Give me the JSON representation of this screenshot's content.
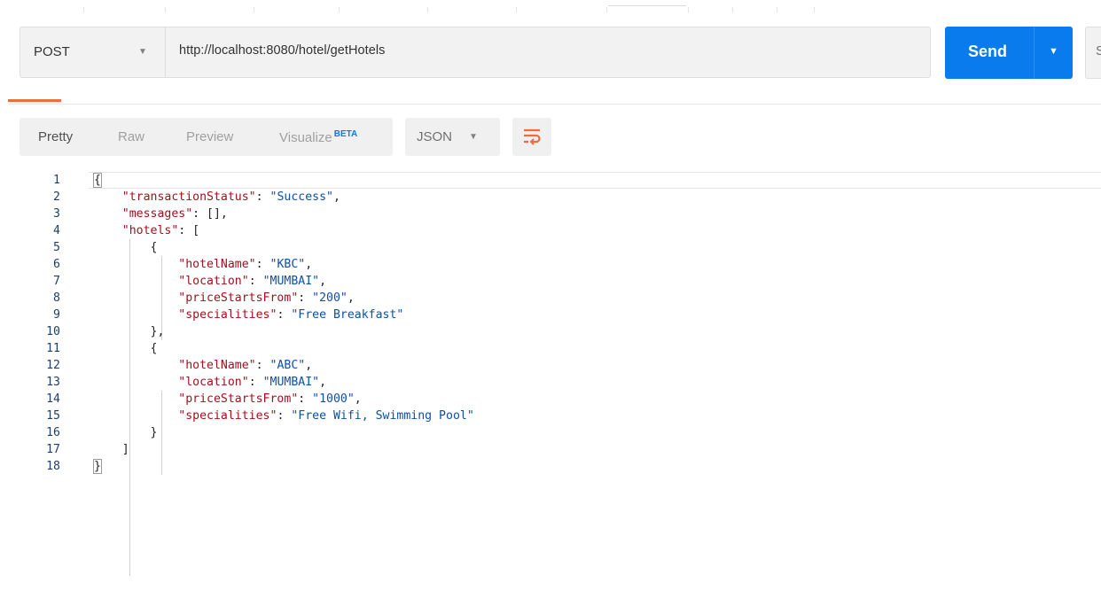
{
  "request": {
    "method": "POST",
    "url": "http://localhost:8080/hotel/getHotels",
    "send_label": "Send",
    "save_label": "S"
  },
  "response": {
    "view_tabs": [
      {
        "label": "Pretty",
        "active": true
      },
      {
        "label": "Raw",
        "active": false
      },
      {
        "label": "Preview",
        "active": false
      },
      {
        "label": "Visualize",
        "badge": "BETA",
        "active": false
      }
    ],
    "format": "JSON",
    "wrap_icon": "text-wrap-icon",
    "code_lines": [
      {
        "n": "1",
        "text": "{"
      },
      {
        "n": "2",
        "text": "    \"transactionStatus\": \"Success\","
      },
      {
        "n": "3",
        "text": "    \"messages\": [],"
      },
      {
        "n": "4",
        "text": "    \"hotels\": ["
      },
      {
        "n": "5",
        "text": "        {"
      },
      {
        "n": "6",
        "text": "            \"hotelName\": \"KBC\","
      },
      {
        "n": "7",
        "text": "            \"location\": \"MUMBAI\","
      },
      {
        "n": "8",
        "text": "            \"priceStartsFrom\": \"200\","
      },
      {
        "n": "9",
        "text": "            \"specialities\": \"Free Breakfast\""
      },
      {
        "n": "10",
        "text": "        },"
      },
      {
        "n": "11",
        "text": "        {"
      },
      {
        "n": "12",
        "text": "            \"hotelName\": \"ABC\","
      },
      {
        "n": "13",
        "text": "            \"location\": \"MUMBAI\","
      },
      {
        "n": "14",
        "text": "            \"priceStartsFrom\": \"1000\","
      },
      {
        "n": "15",
        "text": "            \"specialities\": \"Free Wifi, Swimming Pool\""
      },
      {
        "n": "16",
        "text": "        }"
      },
      {
        "n": "17",
        "text": "    ]"
      },
      {
        "n": "18",
        "text": "}"
      }
    ]
  },
  "colors": {
    "accent": "#097bed",
    "tab_indicator": "#f26b3a",
    "json_key": "#a4101a",
    "json_string": "#0e4fa8"
  }
}
